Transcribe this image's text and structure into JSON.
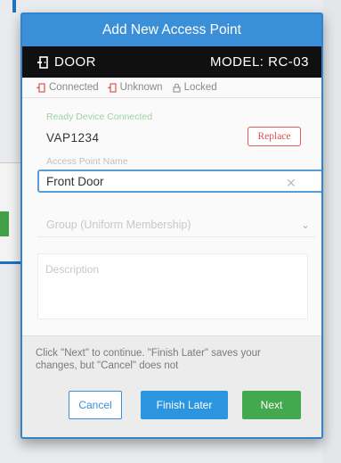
{
  "modal": {
    "title": "Add New Access Point"
  },
  "device_bar": {
    "type_label": "DOOR",
    "model_label": "MODEL: RC-03",
    "icon": "door-icon"
  },
  "status": {
    "connected": "Connected",
    "unknown": "Unknown",
    "locked": "Locked"
  },
  "fields": {
    "serial_label": "Ready Device Connected",
    "serial_value": "VAP1234",
    "replace_label": "Replace",
    "name_label": "Access Point Name",
    "name_value": "Front Door",
    "group_placeholder": "Group (Uniform Membership)",
    "description_label": "Description"
  },
  "footer": {
    "hint": "Click \"Next\" to continue. \"Finish Later\" saves your changes, but \"Cancel\" does not",
    "cancel_label": "Cancel",
    "finish_label": "Finish Later",
    "next_label": "Next"
  },
  "colors": {
    "header_blue": "#3b8fd8",
    "device_bar": "#101010",
    "replace_red": "#d9534f",
    "next_green": "#43a94f",
    "finish_blue": "#2b96df"
  }
}
